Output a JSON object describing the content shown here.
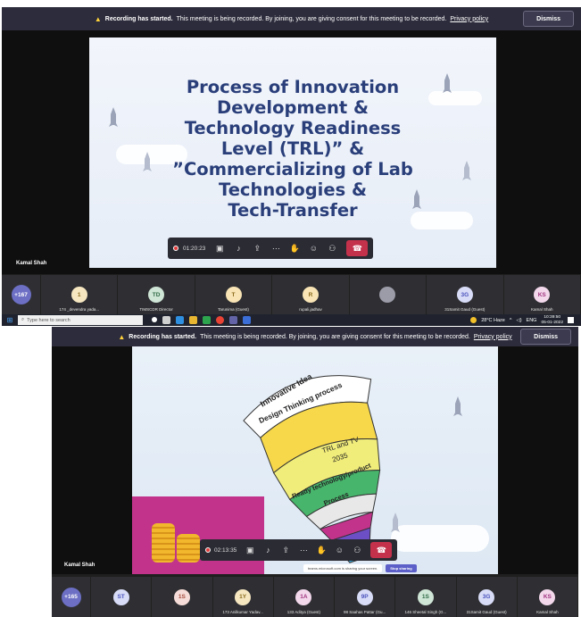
{
  "banner": {
    "bold": "Recording has started.",
    "text": "This meeting is being recorded. By joining, you are giving consent for this meeting to be recorded.",
    "link": "Privacy policy",
    "dismiss": "Dismiss"
  },
  "screen1": {
    "slide_title": "Process of Innovation\nDevelopment &\nTechnology Readiness\nLevel (TRL)” &\n”Commercializing of Lab\nTechnologies &\nTech-Transfer",
    "presenter": "Kamal Shah",
    "timer": "01:20:23",
    "more_count": "+167",
    "participants": [
      {
        "initials": "1",
        "name": "174 _devendra yada...",
        "color": "#f6e7c1",
        "text": "#8a6a1c"
      },
      {
        "initials": "TD",
        "name": "TIMSCDR Director",
        "color": "#cfe5d6",
        "text": "#2f6b45"
      },
      {
        "initials": "T",
        "name": "Tarunima (Guest)",
        "color": "#f8e4b5",
        "text": "#8a6a1c"
      },
      {
        "initials": "R",
        "name": "rupali.jadhav",
        "color": "#f8e4b5",
        "text": "#8a6a1c"
      },
      {
        "initials": "",
        "name": "",
        "color": "#9b9ca8",
        "text": "#ffffff"
      },
      {
        "initials": "3G",
        "name": "31Samit Gaud (Guest)",
        "color": "#d8dcf7",
        "text": "#4b53bc"
      },
      {
        "initials": "KS",
        "name": "Kamal Shah",
        "color": "#f3d8ec",
        "text": "#a0347e"
      }
    ],
    "taskbar": {
      "search_placeholder": "Type here to search",
      "weather": "28°C  Haze",
      "lang": "ENG",
      "time": "10:39:50",
      "date": "05-01-2022"
    }
  },
  "screen2": {
    "slide_labels": [
      "Innovative Idea",
      "Design Thinking process",
      "TRL and TV",
      "2035",
      "Ready technology/product",
      "Process"
    ],
    "presenter": "Kamal Shah",
    "timer": "02:13:35",
    "share_text": "teams.microsoft.com is sharing your screen.",
    "stop_sharing": "Stop sharing",
    "more_count": "+165",
    "participants": [
      {
        "initials": "ST",
        "name": "",
        "color": "#d8dcf7",
        "text": "#4b53bc"
      },
      {
        "initials": "1S",
        "name": "",
        "color": "#f6dcd8",
        "text": "#a34a3c"
      },
      {
        "initials": "1Y",
        "name": "173 Anilkumar Yadav...",
        "color": "#f6e7c1",
        "text": "#8a6a1c"
      },
      {
        "initials": "1A",
        "name": "133 Aditya (Guest)",
        "color": "#f3d8ec",
        "text": "#a0347e"
      },
      {
        "initials": "9P",
        "name": "98 Saahas Pattar (Gu...",
        "color": "#d8dcf7",
        "text": "#4b53bc"
      },
      {
        "initials": "1S",
        "name": "146 Sheetal Singh (G...",
        "color": "#cfe5d6",
        "text": "#2f6b45"
      },
      {
        "initials": "3G",
        "name": "31Samit Gaud (Guest)",
        "color": "#d8dcf7",
        "text": "#4b53bc"
      },
      {
        "initials": "KS",
        "name": "Kamal Shah",
        "color": "#f3d8ec",
        "text": "#a0347e"
      }
    ]
  }
}
